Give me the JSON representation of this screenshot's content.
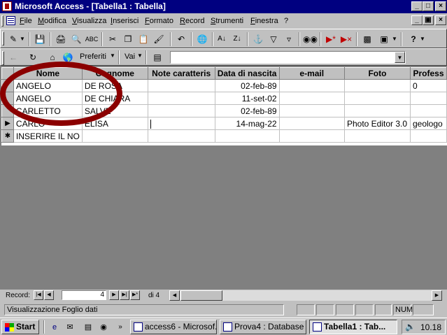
{
  "window": {
    "title": "Microsoft Access - [Tabella1 : Tabella]",
    "min": "_",
    "max": "□",
    "close": "×"
  },
  "menu": [
    "File",
    "Modifica",
    "Visualizza",
    "Inserisci",
    "Formato",
    "Record",
    "Strumenti",
    "Finestra",
    "?"
  ],
  "doc_controls": {
    "min": "_",
    "restore": "▣",
    "close": "×"
  },
  "toolbar": {
    "favorites": "Preferiti",
    "go": "Vai",
    "address_value": ""
  },
  "table": {
    "columns": [
      "Nome",
      "Cognome",
      "Note caratteris",
      "Data di nascita",
      "e-mail",
      "Foto",
      "Profess"
    ],
    "rows": [
      [
        "ANGELO",
        "DE ROSA",
        "",
        "02-feb-89",
        "",
        "",
        "0"
      ],
      [
        "ANGELO",
        "DE CHIARA",
        "",
        "11-set-02",
        "",
        "",
        ""
      ],
      [
        "CARLETTO",
        "SALVE",
        "",
        "02-feb-89",
        "",
        "",
        ""
      ],
      [
        "CARLO",
        "ELISA",
        "",
        "14-mag-22",
        "",
        "Photo Editor 3.0",
        "geologo"
      ]
    ],
    "new_row_text": "INSERIRE IL NO",
    "current_marker": "▶",
    "new_marker": "✱"
  },
  "record_nav": {
    "label": "Record:",
    "current": "4",
    "total_text": "di 4"
  },
  "status": {
    "text": "Visualizzazione Foglio dati",
    "num": "NUM"
  },
  "taskbar": {
    "start": "Start",
    "tasks": [
      "access6 - Microsof...",
      "Prova4 : Database",
      "Tabella1 : Tab..."
    ],
    "active_index": 2,
    "clock": "10.18"
  },
  "colors": {
    "title_bg": "#000080",
    "face": "#c0c0c0",
    "mdi_bg": "#808080",
    "annotation": "#8b0000"
  }
}
